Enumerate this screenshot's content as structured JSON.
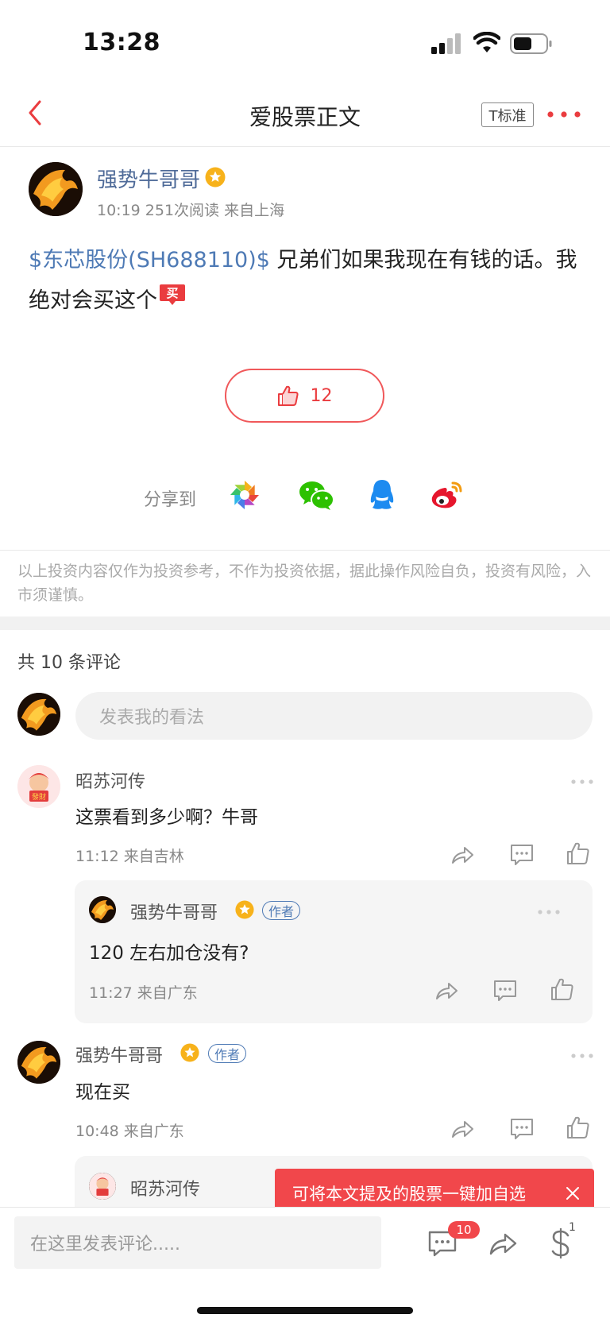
{
  "status": {
    "time": "13:28"
  },
  "nav": {
    "title": "爱股票正文",
    "text_size": "T标准"
  },
  "post": {
    "author": "强势牛哥哥",
    "meta": "10:19 251次阅读 来自上海",
    "stock_tag": "$东芯股份(SH688110)$",
    "text": " 兄弟们如果我现在有钱的话。我绝对会买这个",
    "buy_badge": "买",
    "like_count": "12"
  },
  "share": {
    "label": "分享到",
    "targets": [
      "moments-icon",
      "wechat-icon",
      "qq-icon",
      "weibo-icon"
    ]
  },
  "disclaimer": "以上投资内容仅作为投资参考，不作为投资依据，据此操作风险自负，投资有风险，入市须谨慎。",
  "comments": {
    "count_label": "共 10 条评论",
    "input_placeholder": "发表我的看法",
    "items": [
      {
        "author": "昭苏河传",
        "text": "这票看到多少啊？牛哥",
        "meta": "11:12 来自吉林",
        "reply": {
          "author": "强势牛哥哥",
          "tag": "作者",
          "text": "120 左右加仓没有?",
          "meta": "11:27 来自广东"
        }
      },
      {
        "author": "强势牛哥哥",
        "tag": "作者",
        "text": "现在买",
        "meta": "10:48 来自广东",
        "reply": {
          "author": "昭苏河传"
        }
      }
    ]
  },
  "toast": "可将本文提及的股票一键加自选",
  "bottom": {
    "input_placeholder": "在这里发表评论.....",
    "comment_badge": "10",
    "reward_badge": "1"
  },
  "colors": {
    "accent": "#f1474b",
    "link": "#4e7ab5",
    "username": "#4e6a98"
  }
}
